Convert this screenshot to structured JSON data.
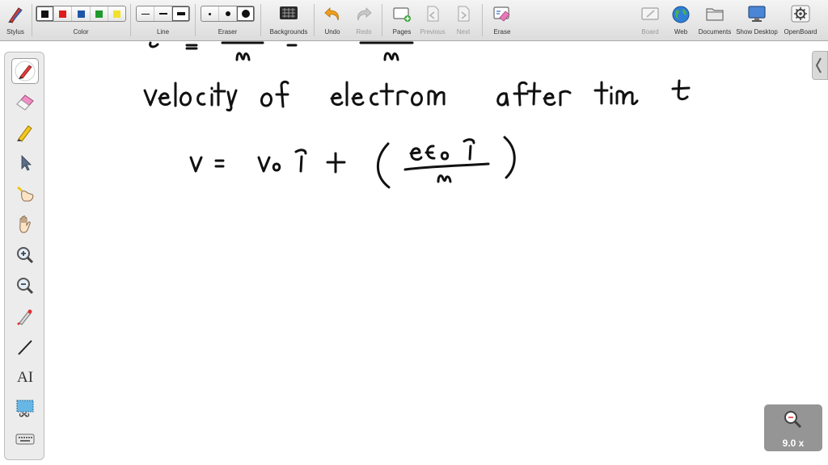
{
  "toolbar": {
    "stylus": "Stylus",
    "color": "Color",
    "line": "Line",
    "eraser": "Eraser",
    "backgrounds": "Backgrounds",
    "undo": "Undo",
    "redo": "Redo",
    "pages": "Pages",
    "previous": "Previous",
    "next": "Next",
    "erase": "Erase",
    "board": "Board",
    "web": "Web",
    "documents": "Documents",
    "show_desktop": "Show Desktop",
    "openboard": "OpenBoard"
  },
  "colors": {
    "swatches": [
      "#111111",
      "#e01b1b",
      "#1f56a8",
      "#1f9a2c",
      "#f2e12a"
    ],
    "ink": "#111111",
    "accent_orange": "#f0a020"
  },
  "left_tools": [
    {
      "name": "pen-tool-icon"
    },
    {
      "name": "eraser-tool-icon"
    },
    {
      "name": "highlighter-tool-icon"
    },
    {
      "name": "selector-tool-icon"
    },
    {
      "name": "pointer-hand-tool-icon"
    },
    {
      "name": "hand-pan-tool-icon"
    },
    {
      "name": "zoom-in-tool-icon"
    },
    {
      "name": "zoom-out-tool-icon"
    },
    {
      "name": "laser-pointer-tool-icon"
    },
    {
      "name": "line-tool-icon"
    },
    {
      "name": "text-tool-icon"
    },
    {
      "name": "capture-tool-icon"
    },
    {
      "name": "keyboard-tool-icon"
    }
  ],
  "text_tool_glyph": "AI",
  "zoom": {
    "label": "9.0 x",
    "value": 9.0
  }
}
